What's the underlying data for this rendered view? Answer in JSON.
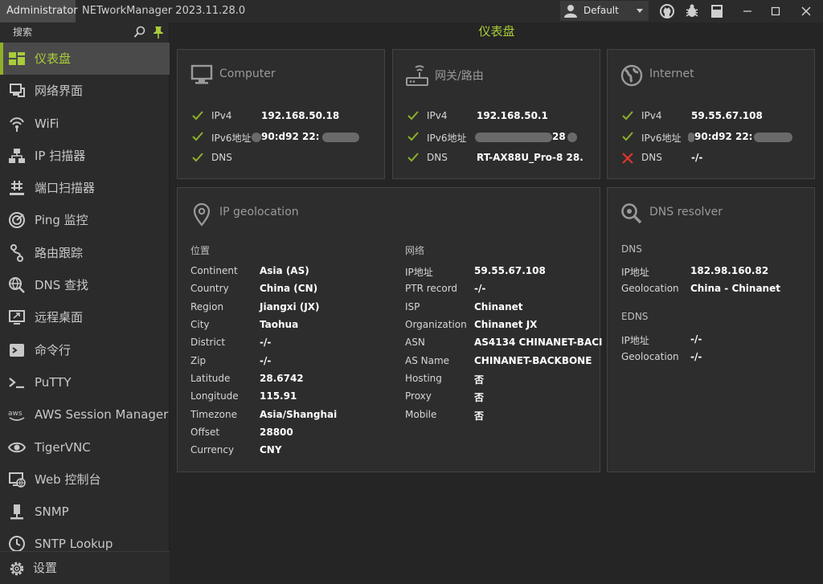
{
  "titlebar": {
    "admin": "Administrator",
    "app_title": "NETworkManager 2023.11.28.0",
    "profile": "Default"
  },
  "sidebar": {
    "search_label": "搜索",
    "items": [
      {
        "label": "仪表盘",
        "icon": "dashboard-icon"
      },
      {
        "label": "网络界面",
        "icon": "network-interface-icon"
      },
      {
        "label": "WiFi",
        "icon": "wifi-icon"
      },
      {
        "label": "IP 扫描器",
        "icon": "ip-scanner-icon"
      },
      {
        "label": "端口扫描器",
        "icon": "port-scanner-icon"
      },
      {
        "label": "Ping 监控",
        "icon": "ping-monitor-icon"
      },
      {
        "label": "路由跟踪",
        "icon": "traceroute-icon"
      },
      {
        "label": "DNS 查找",
        "icon": "dns-lookup-icon"
      },
      {
        "label": "远程桌面",
        "icon": "remote-desktop-icon"
      },
      {
        "label": "命令行",
        "icon": "terminal-icon"
      },
      {
        "label": "PuTTY",
        "icon": "putty-icon"
      },
      {
        "label": "AWS Session Manager",
        "icon": "aws-icon"
      },
      {
        "label": "TigerVNC",
        "icon": "vnc-eye-icon"
      },
      {
        "label": "Web 控制台",
        "icon": "web-console-icon"
      },
      {
        "label": "SNMP",
        "icon": "snmp-icon"
      },
      {
        "label": "SNTP Lookup",
        "icon": "sntp-icon"
      }
    ],
    "settings_label": "设置"
  },
  "main": {
    "title": "仪表盘",
    "computer": {
      "title": "Computer",
      "rows": [
        {
          "key": "IPv4",
          "value": "192.168.50.18",
          "ok": true
        },
        {
          "key": "IPv6地址",
          "value": "90:d92 22:",
          "ok": true
        },
        {
          "key": "DNS",
          "value": "",
          "ok": true
        }
      ]
    },
    "gateway": {
      "title": "网关/路由",
      "rows": [
        {
          "key": "IPv4",
          "value": "192.168.50.1",
          "ok": true
        },
        {
          "key": "IPv6地址",
          "value": "28",
          "ok": true
        },
        {
          "key": "DNS",
          "value": "RT-AX88U_Pro-8 28.",
          "ok": true
        }
      ]
    },
    "internet": {
      "title": "Internet",
      "rows": [
        {
          "key": "IPv4",
          "value": "59.55.67.108",
          "ok": true
        },
        {
          "key": "IPv6地址",
          "value": "90:d92 22:",
          "ok": true
        },
        {
          "key": "DNS",
          "value": "-/-",
          "ok": false
        }
      ]
    },
    "geo": {
      "title": "IP geolocation",
      "location_label": "位置",
      "network_label": "网络",
      "location": [
        {
          "key": "Continent",
          "value": "Asia (AS)"
        },
        {
          "key": "Country",
          "value": "China (CN)"
        },
        {
          "key": "Region",
          "value": "Jiangxi (JX)"
        },
        {
          "key": "City",
          "value": "Taohua"
        },
        {
          "key": "District",
          "value": "-/-"
        },
        {
          "key": "Zip",
          "value": "-/-"
        },
        {
          "key": "Latitude",
          "value": "28.6742"
        },
        {
          "key": "Longitude",
          "value": "115.91"
        },
        {
          "key": "Timezone",
          "value": "Asia/Shanghai"
        },
        {
          "key": "Offset",
          "value": "28800"
        },
        {
          "key": "Currency",
          "value": "CNY"
        }
      ],
      "network": [
        {
          "key": "IP地址",
          "value": "59.55.67.108"
        },
        {
          "key": "PTR record",
          "value": "-/-"
        },
        {
          "key": "ISP",
          "value": "Chinanet"
        },
        {
          "key": "Organization",
          "value": "Chinanet JX"
        },
        {
          "key": "ASN",
          "value": "AS4134 CHINANET-BACI"
        },
        {
          "key": "AS Name",
          "value": "CHINANET-BACKBONE"
        },
        {
          "key": "Hosting",
          "value": "否"
        },
        {
          "key": "Proxy",
          "value": "否"
        },
        {
          "key": "Mobile",
          "value": "否"
        }
      ]
    },
    "dns": {
      "title": "DNS resolver",
      "dns_label": "DNS",
      "edns_label": "EDNS",
      "dns": [
        {
          "key": "IP地址",
          "value": "182.98.160.82"
        },
        {
          "key": "Geolocation",
          "value": "China - Chinanet"
        }
      ],
      "edns": [
        {
          "key": "IP地址",
          "value": "-/-"
        },
        {
          "key": "Geolocation",
          "value": "-/-"
        }
      ]
    }
  },
  "colors": {
    "accent": "#a9cc3a",
    "ok": "#8fb02a",
    "error": "#e0342b",
    "background": "#252525"
  }
}
